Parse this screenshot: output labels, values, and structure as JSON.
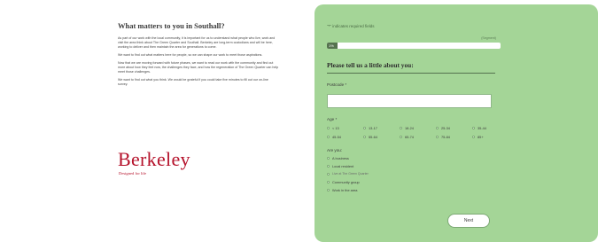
{
  "intro": {
    "heading": "What matters to you in Southall?",
    "paragraphs": [
      "As part of our work with the local community, it is important for us to understand what people who live, work and visit the area think about The Green Quarter and Southall. Berkeley are long-term custodians and will be here, working to deliver and then maintain the area for generations to come.",
      "We want to find out what matters here for people, so we can shape our work to meet those aspirations.",
      "Now that we are moving forward with future phases, we want to read our work with the community and find out more about how they feel now, the challenges they face, and how the regeneration of The Green Quarter can help meet those challenges.",
      "We want to find out what you think. We would be grateful if you could take five minutes to fill out our on-line survey."
    ]
  },
  "logo": {
    "word": "Berkeley",
    "tagline": "Designed for life"
  },
  "form": {
    "required_note": "\"*\" indicates required fields",
    "progress": {
      "percent": 0.06,
      "percent_label": "(Segment)",
      "bar_text": "1%"
    },
    "section_title": "Please tell us a little about you:",
    "postcode_label": "Postcode *",
    "age_label": "Age *",
    "age_options": [
      "< 13",
      "13-17",
      "18-24",
      "25-34",
      "35-44",
      "45-54",
      "55-64",
      "65-74",
      "75-84",
      "85+"
    ],
    "are_you_label": "Are you:",
    "are_you_options": [
      "A business",
      "Local resident",
      "Live at The Green Quarter",
      "Community group",
      "Work in the area"
    ],
    "next_label": "Next"
  }
}
